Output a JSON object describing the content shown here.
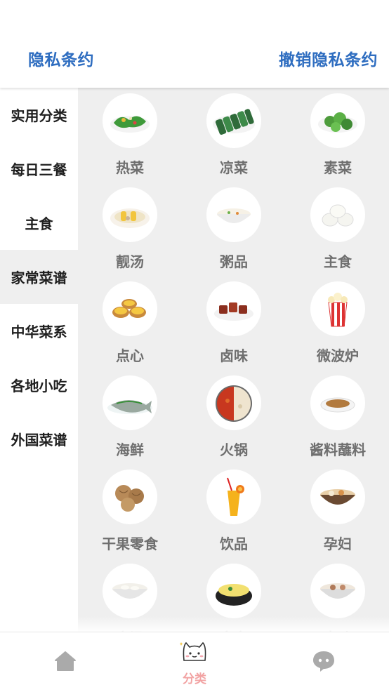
{
  "header": {
    "privacy_label": "隐私条约",
    "revoke_label": "撤销隐私条约"
  },
  "sidebar": {
    "items": [
      {
        "label": "实用分类"
      },
      {
        "label": "每日三餐"
      },
      {
        "label": "主食"
      },
      {
        "label": "家常菜谱",
        "active": true
      },
      {
        "label": "中华菜系"
      },
      {
        "label": "各地小吃"
      },
      {
        "label": "外国菜谱"
      }
    ]
  },
  "categories": [
    {
      "label": "热菜",
      "icon": "stir-fried-greens-icon"
    },
    {
      "label": "凉菜",
      "icon": "cucumber-slices-icon"
    },
    {
      "label": "素菜",
      "icon": "green-vegetables-icon"
    },
    {
      "label": "靓汤",
      "icon": "corn-soup-icon"
    },
    {
      "label": "粥品",
      "icon": "porridge-bowl-icon"
    },
    {
      "label": "主食",
      "icon": "steamed-buns-icon"
    },
    {
      "label": "点心",
      "icon": "egg-tarts-icon"
    },
    {
      "label": "卤味",
      "icon": "braised-meat-icon"
    },
    {
      "label": "微波炉",
      "icon": "popcorn-icon"
    },
    {
      "label": "海鲜",
      "icon": "steamed-fish-icon"
    },
    {
      "label": "火锅",
      "icon": "hotpot-icon"
    },
    {
      "label": "酱料蘸料",
      "icon": "sauce-dip-icon"
    },
    {
      "label": "干果零食",
      "icon": "walnuts-icon"
    },
    {
      "label": "饮品",
      "icon": "juice-drink-icon"
    },
    {
      "label": "孕妇",
      "icon": "nourishing-soup-icon"
    },
    {
      "label": "高汤",
      "icon": "dumpling-soup-icon"
    },
    {
      "label": "宵夜",
      "icon": "stone-pot-stew-icon"
    },
    {
      "label": "春吐",
      "icon": "meat-soup-icon"
    }
  ],
  "bottom_nav": {
    "home_icon": "home-icon",
    "category_label": "分类",
    "category_icon": "cat-face-icon",
    "chat_icon": "chat-bubble-icon",
    "active_color": "#f2a3a3",
    "inactive_color": "#aaaaaa"
  },
  "colors": {
    "accent_link": "#2e6dc0",
    "grid_background": "#efefef",
    "label_gray": "#6f6f6f"
  }
}
